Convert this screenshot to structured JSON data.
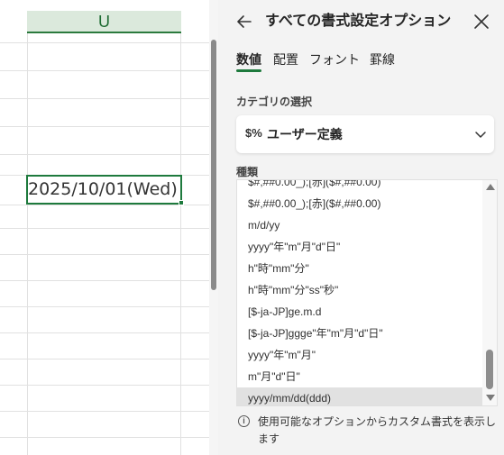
{
  "sheet": {
    "column_header": "U",
    "active_cell_value": "2025/10/01(Wed)"
  },
  "pane": {
    "title": "すべての書式設定オプション",
    "tabs": [
      {
        "label": "数値",
        "active": true
      },
      {
        "label": "配置",
        "active": false
      },
      {
        "label": "フォント",
        "active": false
      },
      {
        "label": "罫線",
        "active": false
      }
    ],
    "category_label": "カテゴリの選択",
    "category_value": "ユーザー定義",
    "category_icon": "$%",
    "type_label": "種類",
    "type_items": [
      "$#,##0.00_);[赤]($#,##0.00)",
      "$#,##0.00_);[赤]($#,##0.00)",
      "m/d/yy",
      "yyyy\"年\"m\"月\"d\"日\"",
      "h\"時\"mm\"分\"",
      "h\"時\"mm\"分\"ss\"秒\"",
      "[$-ja-JP]ge.m.d",
      "[$-ja-JP]ggge\"年\"m\"月\"d\"日\"",
      "yyyy\"年\"m\"月\"",
      "m\"月\"d\"日\"",
      "yyyy/mm/dd(ddd)"
    ],
    "selected_type": "yyyy/mm/dd(ddd)",
    "info_text": "使用可能なオプションからカスタム書式を表示します"
  },
  "colors": {
    "accent_green": "#1e7a3d",
    "header_highlight": "#dbe9dc",
    "pane_background": "#f3f3f3"
  }
}
